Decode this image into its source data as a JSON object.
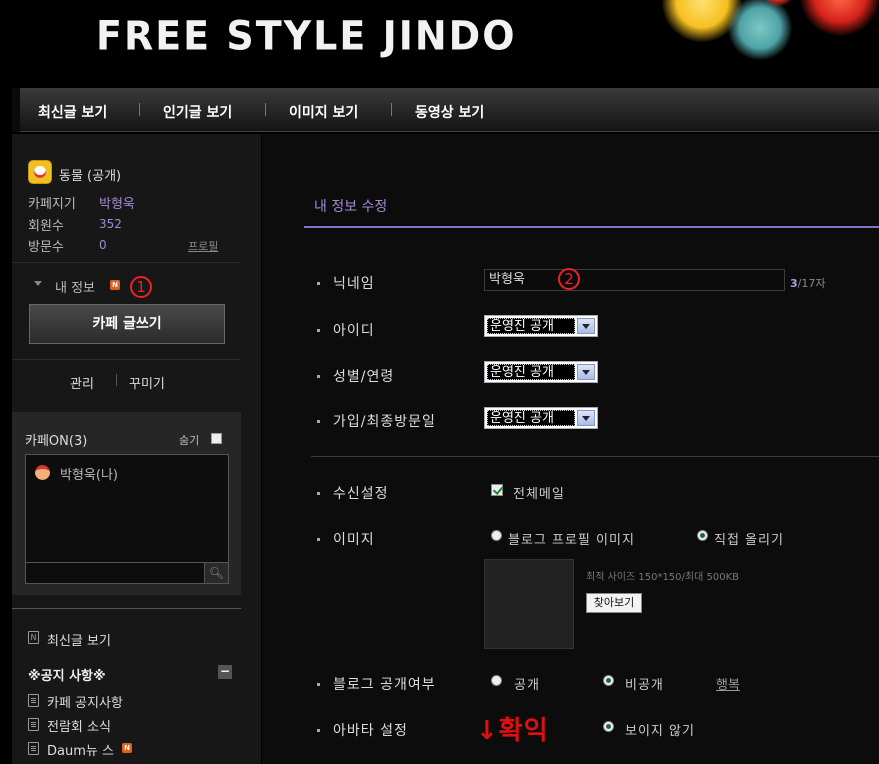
{
  "header": {
    "title": "FREE STYLE JINDO",
    "colors": {
      "bokeh_yellow": "#f5c021",
      "bokeh_red": "#d8231a",
      "bokeh_teal": "#4fa3a6"
    }
  },
  "nav": {
    "items": [
      "최신글 보기",
      "인기글 보기",
      "이미지 보기",
      "동영상 보기"
    ]
  },
  "sidebar": {
    "cafe_name": "동물 (공개)",
    "manager_label": "카페지기",
    "manager_value": "박형욱",
    "members_label": "회원수",
    "members_value": "352",
    "visitors_label": "방문수",
    "visitors_value": "0",
    "profile_link": "프로필",
    "myinfo_label": "내 정보",
    "new_badge": "N",
    "annotation_1": "1",
    "write_button": "카페 글쓰기",
    "manage_link": "관리",
    "decorate_link": "꾸미기",
    "cafeon_title": "카페ON(3)",
    "hide_label": "숨기",
    "cafeon_user": "박형욱(나)",
    "search_icon": "search-icon",
    "latest_link": "최신글 보기",
    "notice_header": "※공지 사항※",
    "collapse_symbol": "−",
    "menu_items": [
      "카페 공지사항",
      "전람회 소식",
      "Daum뉴 스"
    ]
  },
  "main": {
    "section_title": "내 정보 수정",
    "rows": {
      "nickname_label": "닉네임",
      "nickname_value": "박형욱",
      "annotation_2": "2",
      "counter_value": "3",
      "counter_max": "/17자",
      "id_label": "아이디",
      "gender_label": "성별/연령",
      "join_label": "가입/최종방문일",
      "select_value": "운영진 공개",
      "receive_label": "수신설정",
      "receive_option": "전체메일",
      "image_label": "이미지",
      "image_opt_blog": "블로그 프로필 이미지",
      "image_opt_upload": "직접 올리기",
      "image_hint": "최적 사이즈 150*150/최대 500KB",
      "browse_button": "찾아보기",
      "blog_public_label": "블로그 공개여부",
      "public_opt": "공개",
      "private_opt": "비공개",
      "help_link": "행복",
      "avatar_label": "아바타 설정",
      "avatar_opt": "보이지 않기",
      "annotation_check": "↓확익"
    }
  }
}
